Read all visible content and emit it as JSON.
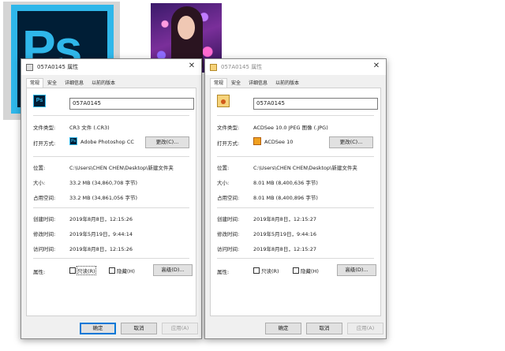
{
  "background": {
    "ps_logo_text": "Ps"
  },
  "dialogs": [
    {
      "title": "057A0145 属性",
      "tabs": [
        "常规",
        "安全",
        "详细信息",
        "以前的版本"
      ],
      "file_name": "057A0145",
      "file_type_label": "文件类型:",
      "file_type": "CR3 文件 (.CR3)",
      "open_with_label": "打开方式:",
      "open_with_app": "Adobe Photoshop CC",
      "app_icon_text": "Ps",
      "change_button": "更改(C)...",
      "location_label": "位置:",
      "location": "C:\\Users\\CHEN CHEN\\Desktop\\新建文件夹",
      "size_label": "大小:",
      "size": "33.2 MB (34,860,708 字节)",
      "disk_size_label": "占用空间:",
      "disk_size": "33.2 MB (34,861,056 字节)",
      "created_label": "创建时间:",
      "created": "2019年8月8日，12:15:26",
      "modified_label": "修改时间:",
      "modified": "2019年5月19日，9:44:14",
      "accessed_label": "访问时间:",
      "accessed": "2019年8月8日，12:15:26",
      "attributes_label": "属性:",
      "readonly_label": "只读(R)",
      "hidden_label": "隐藏(H)",
      "advanced_button": "高级(D)...",
      "ok_button": "确定",
      "cancel_button": "取消",
      "apply_button": "应用(A)"
    },
    {
      "title": "057A0145 属性",
      "tabs": [
        "常规",
        "安全",
        "详细信息",
        "以前的版本"
      ],
      "file_name": "057A0145",
      "file_type_label": "文件类型:",
      "file_type": "ACDSee 10.0 JPEG 图像 (.JPG)",
      "open_with_label": "打开方式:",
      "open_with_app": "ACDSee 10",
      "change_button": "更改(C)...",
      "location_label": "位置:",
      "location": "C:\\Users\\CHEN CHEN\\Desktop\\新建文件夹",
      "size_label": "大小:",
      "size": "8.01 MB (8,400,636 字节)",
      "disk_size_label": "占用空间:",
      "disk_size": "8.01 MB (8,400,896 字节)",
      "created_label": "创建时间:",
      "created": "2019年8月8日，12:15:27",
      "modified_label": "修改时间:",
      "modified": "2019年5月19日，9:44:16",
      "accessed_label": "访问时间:",
      "accessed": "2019年8月8日，12:15:27",
      "attributes_label": "属性:",
      "readonly_label": "只读(R)",
      "hidden_label": "隐藏(H)",
      "advanced_button": "高级(D)...",
      "ok_button": "确定",
      "cancel_button": "取消",
      "apply_button": "应用(A)"
    }
  ]
}
